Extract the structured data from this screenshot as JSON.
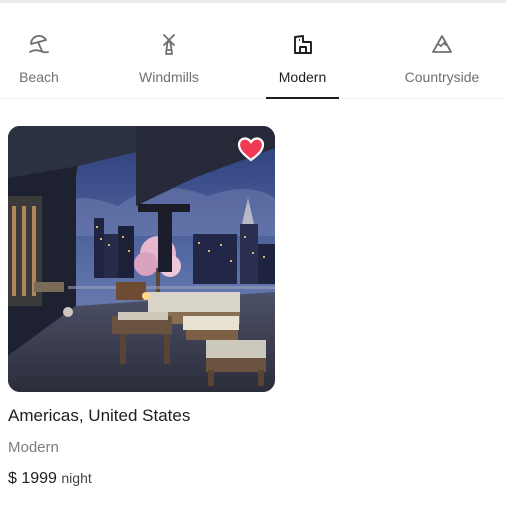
{
  "categories": [
    {
      "label": "Beach",
      "icon": "beach-umbrella-icon"
    },
    {
      "label": "Windmills",
      "icon": "windmill-icon"
    },
    {
      "label": "Modern",
      "icon": "modern-house-icon"
    },
    {
      "label": "Countryside",
      "icon": "mountain-icon"
    }
  ],
  "active_category": "Modern",
  "listing": {
    "title": "Americas, United States",
    "category": "Modern",
    "price": "$ 1999",
    "price_unit": "night",
    "favorited": true
  },
  "colors": {
    "favorite": "#f03a55",
    "active_text": "#1d1d1d",
    "inactive_text": "#707070"
  }
}
